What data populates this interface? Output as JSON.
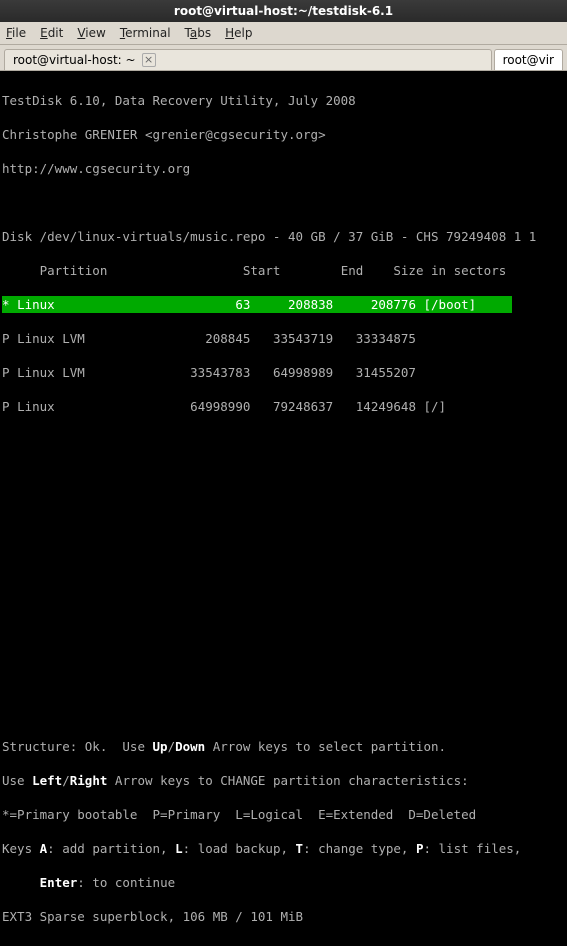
{
  "window": {
    "title": "root@virtual-host:~/testdisk-6.1"
  },
  "menu": {
    "file": "File",
    "edit": "Edit",
    "view": "View",
    "terminal": "Terminal",
    "tabs": "Tabs",
    "help": "Help"
  },
  "tabs": {
    "t0": {
      "label": "root@virtual-host: ~"
    },
    "t1": {
      "label": "root@vir"
    }
  },
  "app": {
    "title_line": "TestDisk 6.10, Data Recovery Utility, July 2008",
    "author_line": "Christophe GRENIER <grenier@cgsecurity.org>",
    "url_line": "http://www.cgsecurity.org"
  },
  "disk_line": "Disk /dev/linux-virtuals/music.repo - 40 GB / 37 GiB - CHS 79249408 1 1",
  "header": {
    "partition": "     Partition",
    "start": "Start",
    "end": "End",
    "size": "Size in sectors"
  },
  "rows": [
    {
      "flag": "*",
      "name": "Linux",
      "start": "63",
      "end": "208838",
      "size": "208776 [/boot]",
      "hl": true
    },
    {
      "flag": "P",
      "name": "Linux LVM",
      "start": "208845",
      "end": "33543719",
      "size": "33334875"
    },
    {
      "flag": "P",
      "name": "Linux LVM",
      "start": "33543783",
      "end": "64998989",
      "size": "31455207"
    },
    {
      "flag": "P",
      "name": "Linux",
      "start": "64998990",
      "end": "79248637",
      "size": "14249648 [/]"
    }
  ],
  "footer": {
    "l1a": "Structure: Ok.  Use ",
    "l1b": "Up",
    "l1c": "/",
    "l1d": "Down",
    "l1e": " Arrow keys to select partition.",
    "l2a": "Use ",
    "l2b": "Left",
    "l2c": "/",
    "l2d": "Right",
    "l2e": " Arrow keys to CHANGE partition characteristics:",
    "l3": "*=Primary bootable  P=Primary  L=Logical  E=Extended  D=Deleted",
    "l4a": "Keys ",
    "l4b": "A",
    "l4c": ": add partition, ",
    "l4d": "L",
    "l4e": ": load backup, ",
    "l4f": "T",
    "l4g": ": change type, ",
    "l4h": "P",
    "l4i": ": list files,",
    "l5a": "     ",
    "l5b": "Enter",
    "l5c": ": to continue",
    "l6": "EXT3 Sparse superblock, 106 MB / 101 MiB"
  }
}
